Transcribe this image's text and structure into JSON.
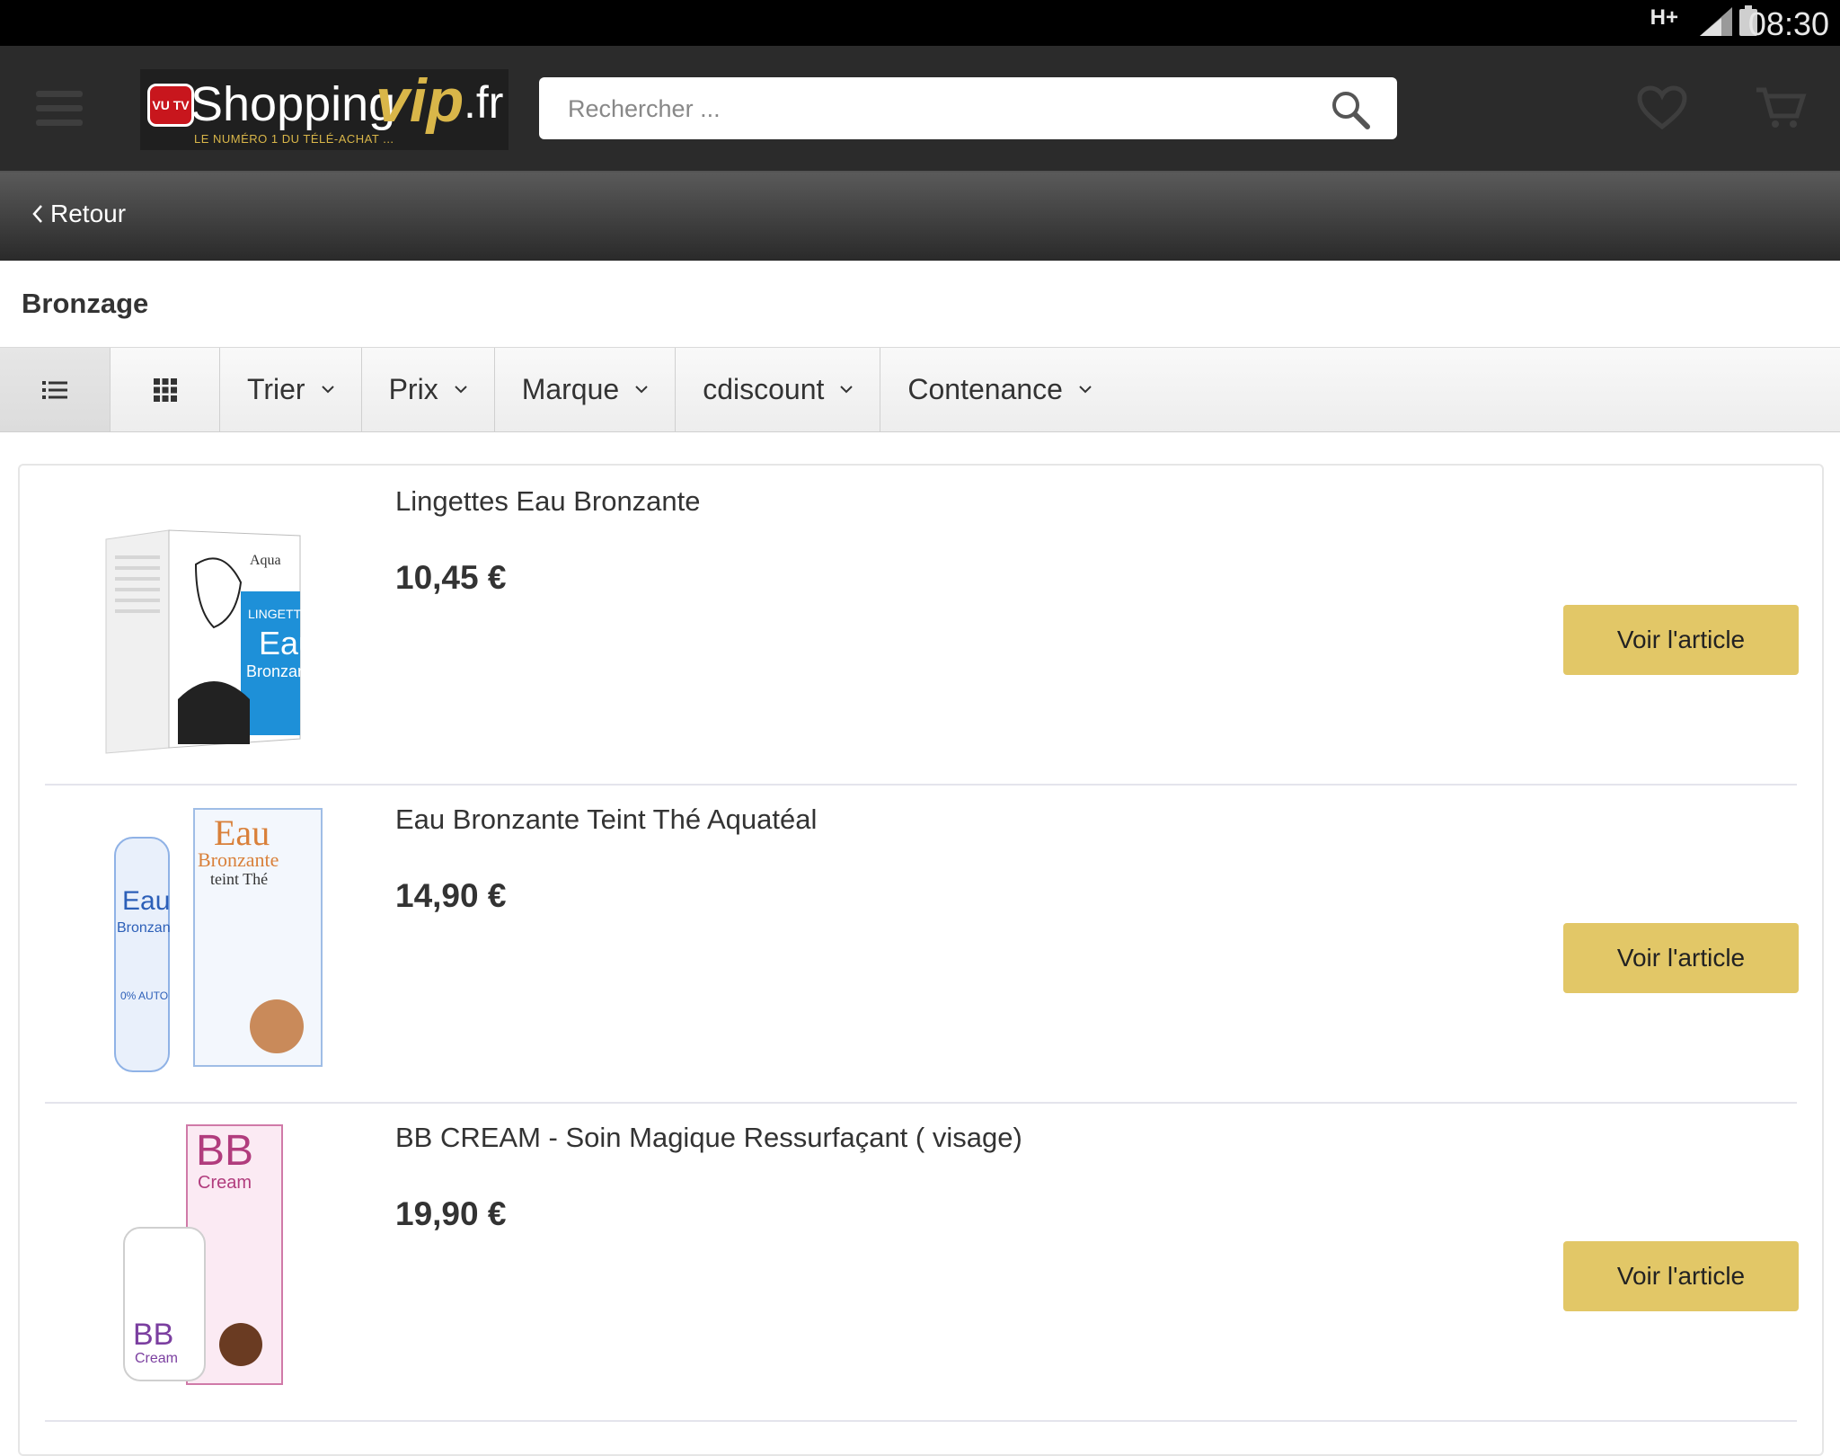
{
  "status": {
    "network": "H+",
    "time": "08:30"
  },
  "header": {
    "logo": {
      "tv": "VU TV",
      "shopping": "Shopping",
      "vip": "vip",
      "fr": ".fr",
      "tagline": "LE NUMÉRO 1 DU TÉLÉ-ACHAT ..."
    },
    "search": {
      "placeholder": "Rechercher ..."
    }
  },
  "nav": {
    "back_label": "Retour"
  },
  "category": {
    "title": "Bronzage"
  },
  "toolbar": {
    "filters": [
      {
        "label": "Trier"
      },
      {
        "label": "Prix"
      },
      {
        "label": "Marque"
      },
      {
        "label": "cdiscount"
      },
      {
        "label": "Contenance"
      }
    ]
  },
  "products": [
    {
      "title": "Lingettes Eau Bronzante",
      "price": "10,45 €",
      "button": "Voir l'article"
    },
    {
      "title": "Eau Bronzante Teint Thé Aquatéal",
      "price": "14,90 €",
      "button": "Voir l'article"
    },
    {
      "title": "BB CREAM - Soin Magique Ressurfaçant ( visage)",
      "price": "19,90 €",
      "button": "Voir l'article"
    }
  ],
  "colors": {
    "header_bg": "#2b2b2b",
    "accent_gold": "#e2c767",
    "logo_red": "#c8161d"
  }
}
